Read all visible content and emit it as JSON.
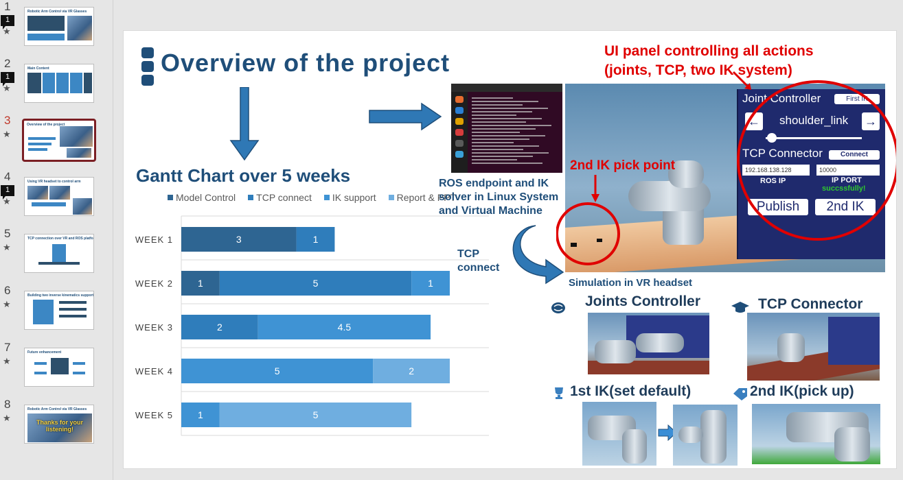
{
  "thumbnails": [
    {
      "number": "1",
      "comments": "1",
      "title": "Robotic Arm Control via VR Glasses",
      "active": false
    },
    {
      "number": "2",
      "comments": "1",
      "title": "Main Content",
      "active": false
    },
    {
      "number": "3",
      "comments": "",
      "title": "Overview of the project",
      "active": true
    },
    {
      "number": "4",
      "comments": "1",
      "title": "Using VR headset to control arm",
      "active": false
    },
    {
      "number": "5",
      "comments": "",
      "title": "TCP connection over VR and ROS platform",
      "active": false
    },
    {
      "number": "6",
      "comments": "",
      "title": "Building two inverse kinematics support",
      "active": false
    },
    {
      "number": "7",
      "comments": "",
      "title": "Future enhancement",
      "active": false
    },
    {
      "number": "8",
      "comments": "",
      "title": "Robotic Arm Control via VR Glasses",
      "thanks": "Thanks for your listening!",
      "active": false
    }
  ],
  "thumb_star": "★",
  "slide": {
    "title": "Overview of the project",
    "gantt_title": "Gantt Chart over 5 weeks",
    "ros_label": "ROS endpoint and IK solver in Linux System and Virtual Machine",
    "tcp_label": "TCP connect",
    "ui_label_line1": "UI panel controlling all actions",
    "ui_label_line2": "(joints, TCP, two IK system)",
    "ik2_pick_label": "2nd IK pick point",
    "sim_label": "Simulation in VR headset",
    "joints_controller_label": "Joints Controller",
    "tcp_connector_label": "TCP Connector",
    "ik1_label": "1st IK(set default)",
    "ik2_label": "2nd IK(pick up)"
  },
  "vr_panel": {
    "joint_controller": "Joint Controller",
    "first_ik": "First IK",
    "left_arrow": "←",
    "right_arrow": "→",
    "joint_name": "shoulder_link",
    "tcp_connector": "TCP Connector",
    "connect": "Connect",
    "ip_value": "192.168.138.128",
    "port_value": "10000",
    "ros_ip": "ROS IP",
    "ip_port": "IP PORT",
    "status": "succssfully!",
    "publish": "Publish",
    "second_ik": "2nd IK"
  },
  "chart_data": {
    "type": "bar",
    "orientation": "horizontal",
    "stacked": true,
    "categories": [
      "WEEK 1",
      "WEEK 2",
      "WEEK 3",
      "WEEK 4",
      "WEEK 5"
    ],
    "series": [
      {
        "name": "Model Control",
        "values": [
          3,
          1,
          0,
          0,
          0
        ],
        "color": "#2e6592"
      },
      {
        "name": "TCP connect",
        "values": [
          1,
          5,
          2,
          0,
          0
        ],
        "color": "#2f7dbb"
      },
      {
        "name": "IK support",
        "values": [
          0,
          1,
          4.5,
          5,
          1
        ],
        "color": "#3f93d4"
      },
      {
        "name": "Report & PPT",
        "values": [
          0,
          0,
          0,
          2,
          5
        ],
        "color": "#6faee0"
      }
    ],
    "bar_labels": [
      [
        "3",
        "1",
        "0"
      ],
      [
        "1",
        "5",
        "1"
      ],
      [
        "2",
        "4.5"
      ],
      [
        "5",
        "2"
      ],
      [
        "1",
        "5"
      ]
    ],
    "xlim": [
      0,
      8
    ],
    "legend_position": "top"
  }
}
